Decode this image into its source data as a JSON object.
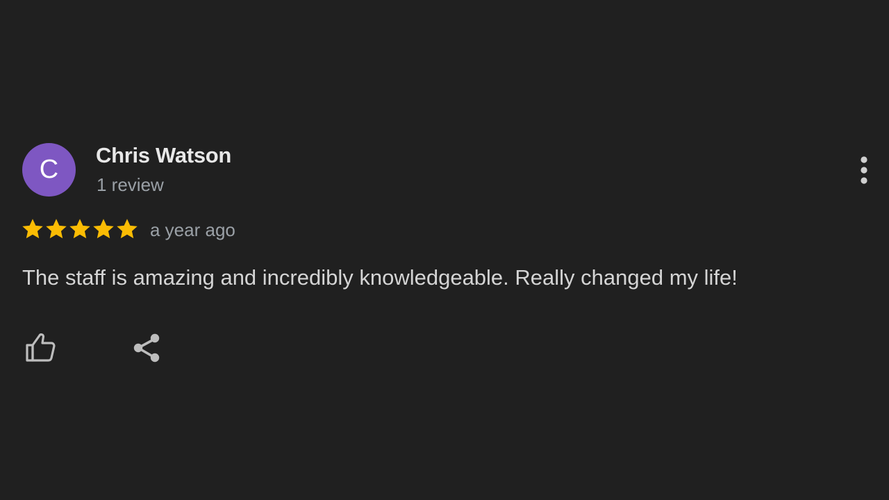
{
  "review": {
    "author": {
      "initial": "C",
      "name": "Chris Watson",
      "review_count": "1 review",
      "avatar_color": "#7e57c2"
    },
    "rating": 5,
    "rating_max": 5,
    "date": "a year ago",
    "text": "The staff is amazing and incredibly knowledgeable. Really changed my life!"
  },
  "actions": {
    "more_icon": "more-vert-icon",
    "like_icon": "thumb-up-icon",
    "share_icon": "share-icon"
  },
  "colors": {
    "background": "#202020",
    "star": "#fbbc04",
    "name": "#e8e8e8",
    "secondary_text": "#9aa0a6",
    "body_text": "#d4d4d4",
    "icon": "#bdbdbd"
  }
}
